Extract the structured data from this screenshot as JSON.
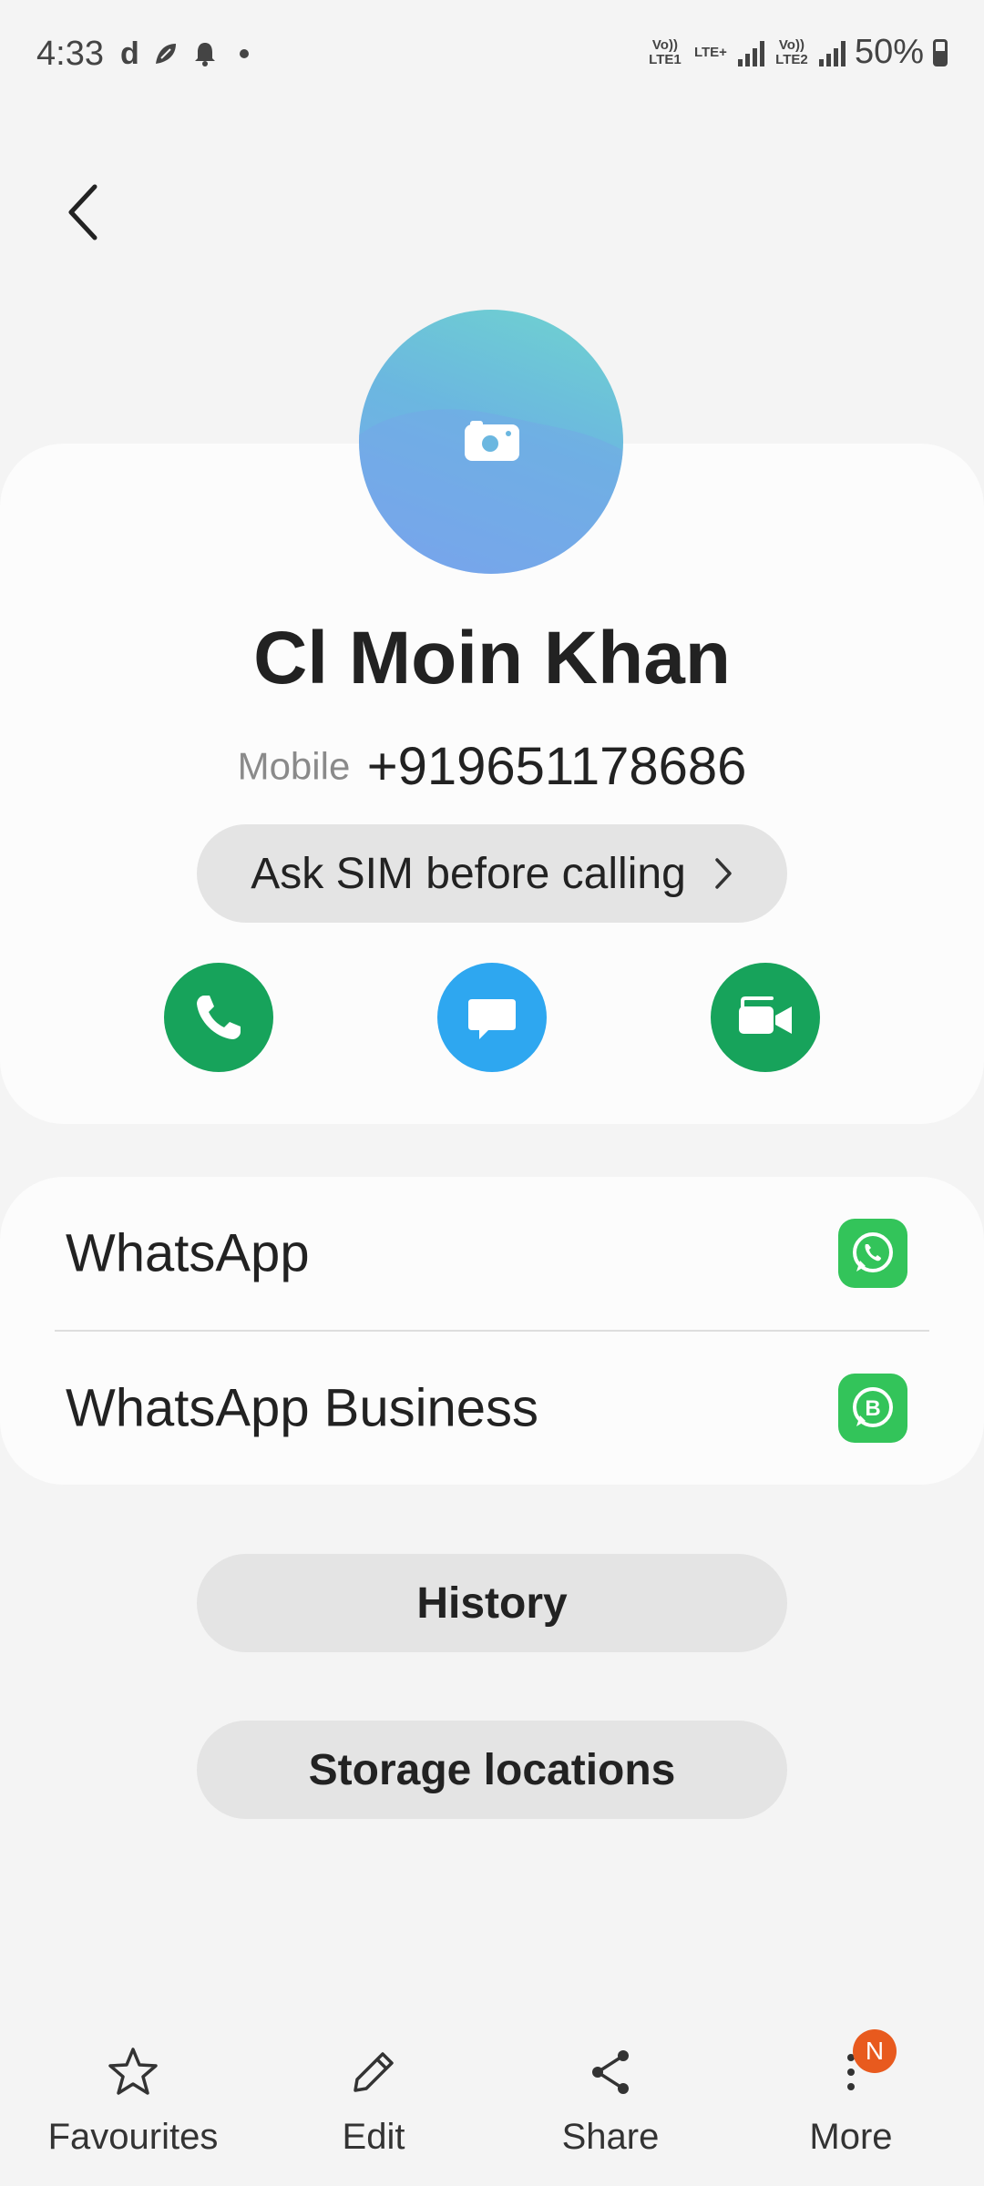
{
  "status_bar": {
    "time": "4:33",
    "left_icons": [
      "d-app-icon",
      "leaf-icon",
      "bell-icon",
      "dot-icon"
    ],
    "sim1_label": "Vo)) LTE1",
    "net_label": "LTE+",
    "sim2_label": "Vo)) LTE2",
    "battery": "50%"
  },
  "header": {
    "back_icon": "back-chevron-icon"
  },
  "contact": {
    "name": "Cl Moin Khan",
    "phone_type": "Mobile",
    "phone_number": "+919651178686",
    "sim_choice": "Ask SIM before calling"
  },
  "actions": {
    "call_icon": "phone-icon",
    "message_icon": "message-icon",
    "video_icon": "video-call-icon",
    "call_color": "#17a35b",
    "message_color": "#2ea7f0",
    "video_color": "#17a35b"
  },
  "apps": [
    {
      "label": "WhatsApp",
      "icon": "whatsapp-icon"
    },
    {
      "label": "WhatsApp Business",
      "icon": "whatsapp-business-icon"
    }
  ],
  "buttons": {
    "history": "History",
    "storage": "Storage locations"
  },
  "bottom_nav": [
    {
      "label": "Favourites",
      "icon": "star-icon"
    },
    {
      "label": "Edit",
      "icon": "pencil-icon"
    },
    {
      "label": "Share",
      "icon": "share-icon"
    },
    {
      "label": "More",
      "icon": "more-vertical-icon",
      "badge": "N"
    }
  ]
}
